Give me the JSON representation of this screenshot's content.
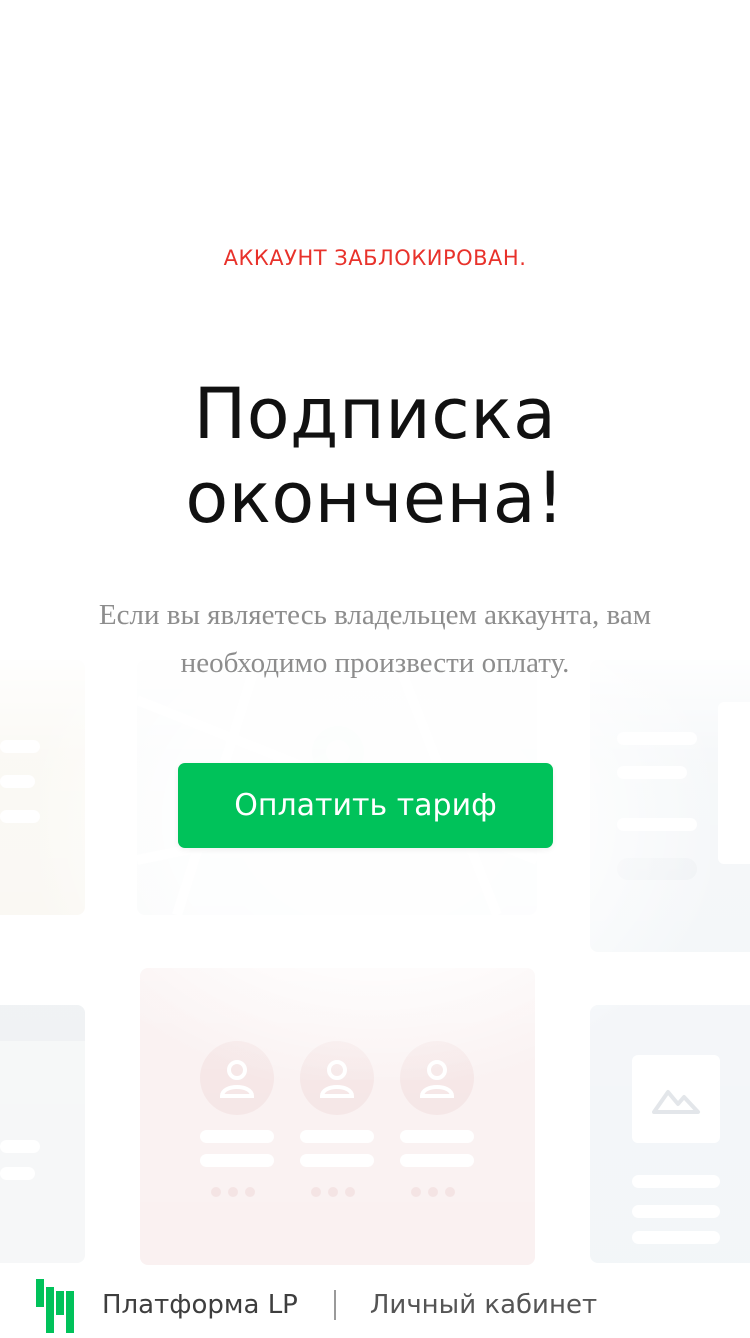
{
  "status_text": "АККАУНТ ЗАБЛОКИРОВАН.",
  "title_line1": "Подписка",
  "title_line2": "окончена!",
  "description": "Если вы являетесь владельцем аккаунта, вам необходимо произвести оплату.",
  "pay_button_label": "Оплатить тариф",
  "footer": {
    "brand": "Платформа LP",
    "cabinet_link": "Личный кабинет"
  },
  "colors": {
    "status": "#e8322b",
    "accent": "#00c25a",
    "title": "#111111",
    "description": "#8d8d8d"
  },
  "icons": [
    "person-icon",
    "mountain-image-icon",
    "map-pin-icon",
    "platforma-lp-logo"
  ]
}
